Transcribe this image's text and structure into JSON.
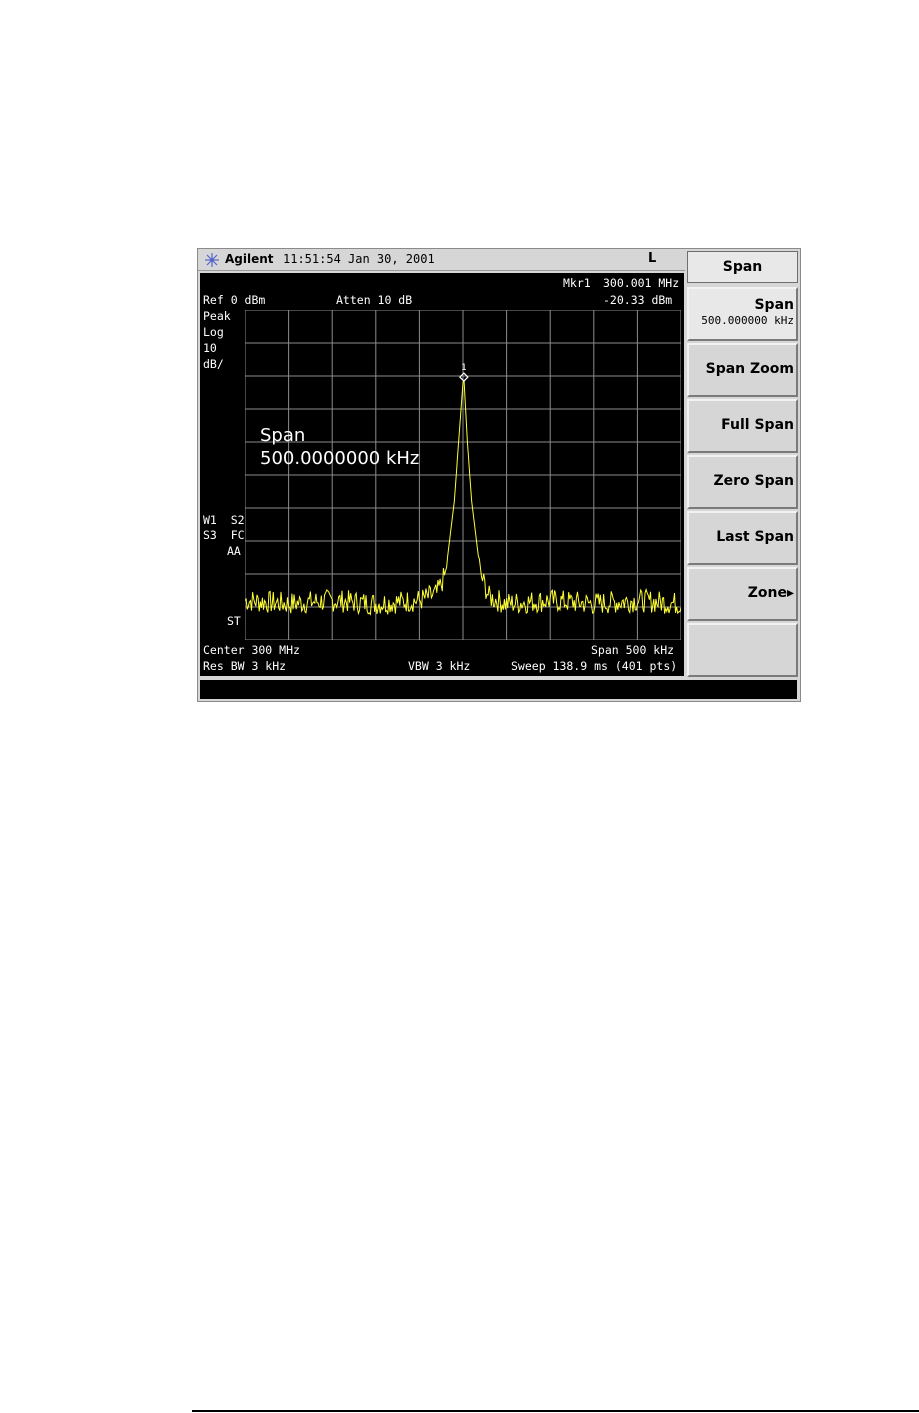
{
  "header": {
    "brand": "Agilent",
    "time": "11:51:54",
    "date": "Jan 30, 2001",
    "indicator": "L"
  },
  "display": {
    "marker_label": "Mkr1",
    "marker_freq": "300.001 MHz",
    "marker_amp": "-20.33 dBm",
    "ref_level": "Ref 0 dBm",
    "atten": "Atten 10 dB",
    "detector": "Peak",
    "scale_type": "Log",
    "scale_value": "10",
    "scale_unit": "dB/",
    "trace_flags_1": "W1  S2",
    "trace_flags_2": "S3  FC",
    "trace_flags_3": "AA",
    "trace_flags_4": "ST",
    "active_function_name": "Span",
    "active_function_value": "500.0000000 kHz",
    "center": "Center 300 MHz",
    "span": "Span 500 kHz",
    "res_bw": "Res BW 3 kHz",
    "vbw": "VBW 3 kHz",
    "sweep": "Sweep 138.9 ms (401 pts)",
    "marker_number": "1",
    "trace_color": "#ffff33"
  },
  "softkeys": {
    "menu_title": "Span",
    "items": [
      {
        "label": "Span",
        "value": "500.000000 kHz"
      },
      {
        "label": "Span Zoom"
      },
      {
        "label": "Full Span"
      },
      {
        "label": "Zero Span"
      },
      {
        "label": "Last Span"
      },
      {
        "label": "Zone▸"
      },
      {
        "label": ""
      }
    ]
  },
  "chart_data": {
    "type": "line",
    "x_unit": "MHz",
    "y_unit": "dBm",
    "xlim": [
      299.75,
      300.25
    ],
    "ylim": [
      -100,
      0
    ],
    "grid": true,
    "series": [
      {
        "x": [
          299.75,
          299.8,
          299.85,
          299.9,
          299.95,
          299.97,
          299.98,
          299.99,
          299.995,
          300.0,
          300.001,
          300.005,
          300.01,
          300.02,
          300.03,
          300.05,
          300.1,
          300.15,
          300.2,
          300.25
        ],
        "values": [
          -88,
          -89,
          -88,
          -89,
          -88,
          -86,
          -80,
          -58,
          -40,
          -22,
          -20.33,
          -40,
          -58,
          -80,
          -87,
          -89,
          -88,
          -89,
          -88,
          -89
        ]
      }
    ],
    "marker": {
      "x": 300.001,
      "y": -20.33
    }
  }
}
